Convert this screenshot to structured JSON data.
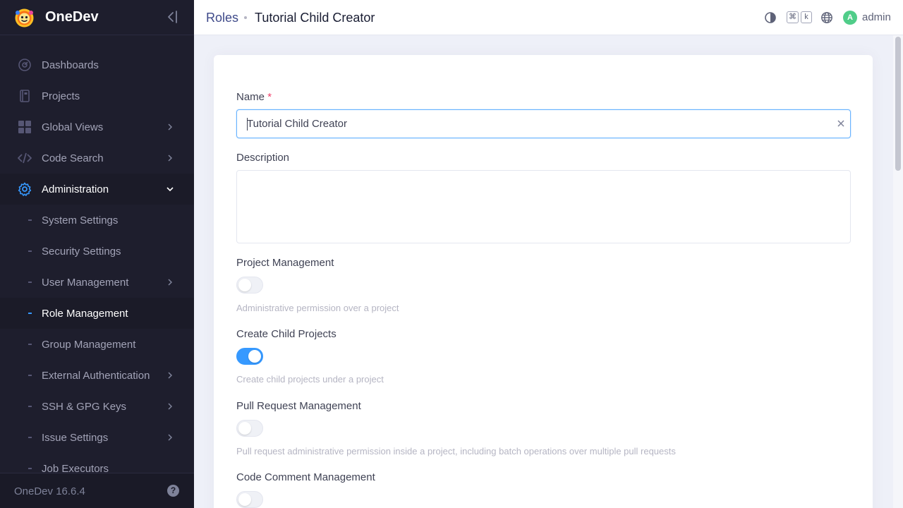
{
  "app": {
    "name": "OneDev",
    "version": "OneDev 16.6.4"
  },
  "sidebar": {
    "items": [
      {
        "label": "Dashboards",
        "icon": "dashboard-icon"
      },
      {
        "label": "Projects",
        "icon": "projects-icon"
      },
      {
        "label": "Global Views",
        "icon": "grid-icon"
      },
      {
        "label": "Code Search",
        "icon": "code-icon"
      },
      {
        "label": "Administration",
        "icon": "gear-icon"
      },
      {
        "label": "System Settings"
      },
      {
        "label": "Security Settings"
      },
      {
        "label": "User Management"
      },
      {
        "label": "Role Management"
      },
      {
        "label": "Group Management"
      },
      {
        "label": "External Authentication"
      },
      {
        "label": "SSH & GPG Keys"
      },
      {
        "label": "Issue Settings"
      },
      {
        "label": "Job Executors"
      }
    ],
    "help_icon": "?"
  },
  "header": {
    "breadcrumb_root": "Roles",
    "title": "Tutorial Child Creator",
    "kbd": [
      "⌘",
      "k"
    ],
    "avatar_letter": "A",
    "username": "admin"
  },
  "form": {
    "name_label": "Name",
    "name_required": "*",
    "name_value": "Tutorial Child Creator",
    "description_label": "Description",
    "description_value": "",
    "permissions": [
      {
        "label": "Project Management",
        "help": "Administrative permission over a project",
        "enabled": false
      },
      {
        "label": "Create Child Projects",
        "help": "Create child projects under a project",
        "enabled": true
      },
      {
        "label": "Pull Request Management",
        "help": "Pull request administrative permission inside a project, including batch operations over multiple pull requests",
        "enabled": false
      },
      {
        "label": "Code Comment Management",
        "help": "",
        "enabled": false
      }
    ]
  },
  "colors": {
    "accent": "#3699ff",
    "sidebar_bg": "#1e1e2d",
    "required": "#f1416c"
  }
}
